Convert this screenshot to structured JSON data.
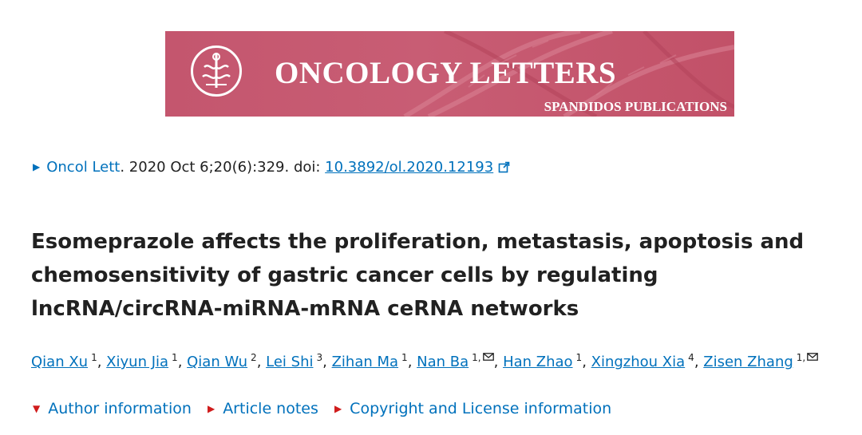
{
  "banner": {
    "title": "ONCOLOGY LETTERS",
    "publisher": "SPANDIDOS PUBLICATIONS",
    "color": "#c4566e"
  },
  "citation": {
    "journal": "Oncol Lett",
    "details": ". 2020 Oct 6;20(6):329. doi: ",
    "doi": "10.3892/ol.2020.12193"
  },
  "article": {
    "title": "Esomeprazole affects the proliferation, metastasis, apoptosis and chemosensitivity of gastric cancer cells by regulating lncRNA/circRNA-miRNA-mRNA ceRNA networks"
  },
  "authors": [
    {
      "name": "Qian Xu",
      "aff": "1",
      "sep": ", "
    },
    {
      "name": "Xiyun Jia",
      "aff": "1",
      "sep": ", "
    },
    {
      "name": "Qian Wu",
      "aff": "2",
      "sep": ", "
    },
    {
      "name": "Lei Shi",
      "aff": "3",
      "sep": ", "
    },
    {
      "name": "Zihan Ma",
      "aff": "1",
      "sep": ", "
    },
    {
      "name": "Nan Ba",
      "aff": "1,",
      "sep": ", "
    },
    {
      "name": "Han Zhao",
      "aff": "1",
      "sep": ", "
    },
    {
      "name": "Xingzhou Xia",
      "aff": "4",
      "sep": ", "
    },
    {
      "name": "Zisen Zhang",
      "aff": "1,",
      "sep": ""
    }
  ],
  "links": {
    "author_info": "Author information",
    "article_notes": "Article notes",
    "copyright": "Copyright and License information"
  },
  "colors": {
    "link": "#0071bc",
    "accent_triangle": "#d01c1c"
  }
}
